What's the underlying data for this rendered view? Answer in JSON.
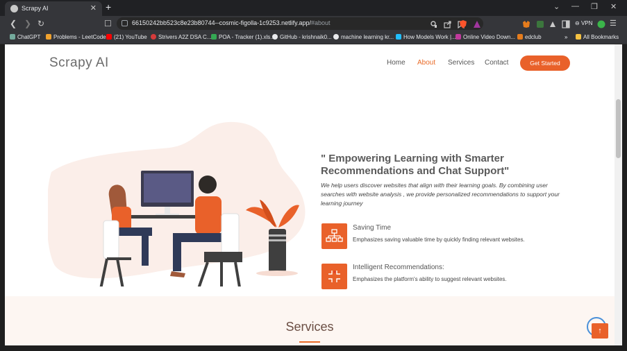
{
  "browser": {
    "tab_title": "Scrapy AI",
    "url_main": "66150242bb523c8e23b80744--cosmic-figolla-1c9253.netlify.app/",
    "url_hash": "#about",
    "vpn_label": "VPN",
    "bookmarks": [
      "ChatGPT",
      "Problems - LeetCode",
      "(21) YouTube",
      "Strivers A2Z DSA C...",
      "POA - Tracker (1).xls...",
      "GitHub - krishnaik0...",
      "machine learning kr...",
      "How Models Work |...",
      "Online Video Down...",
      "edclub"
    ],
    "all_bookmarks": "All Bookmarks",
    "bookmark_overflow": "»"
  },
  "site": {
    "logo": "Scrapy AI",
    "nav": [
      "Home",
      "About",
      "Services",
      "Contact"
    ],
    "active_nav": "About",
    "cta": "Get Started"
  },
  "about": {
    "headline": "\" Empowering Learning with Smarter Recommendations and Chat Support\"",
    "description": "We help users discover websites that align with their learning goals. By combining user searches with website analysis , we provide personalized recommendations to support your learning journey",
    "features": [
      {
        "title": "Saving Time",
        "desc": "Emphasizes saving valuable time by quickly finding relevant websites.",
        "icon": "sitemap-icon"
      },
      {
        "title": "Intelligent Recommendations:",
        "desc": "Emphasizes the platform's ability to suggest relevant websites.",
        "icon": "compress-icon"
      }
    ]
  },
  "services": {
    "title": "Services"
  },
  "colors": {
    "accent": "#e9612a",
    "blob": "#fbeee9"
  }
}
